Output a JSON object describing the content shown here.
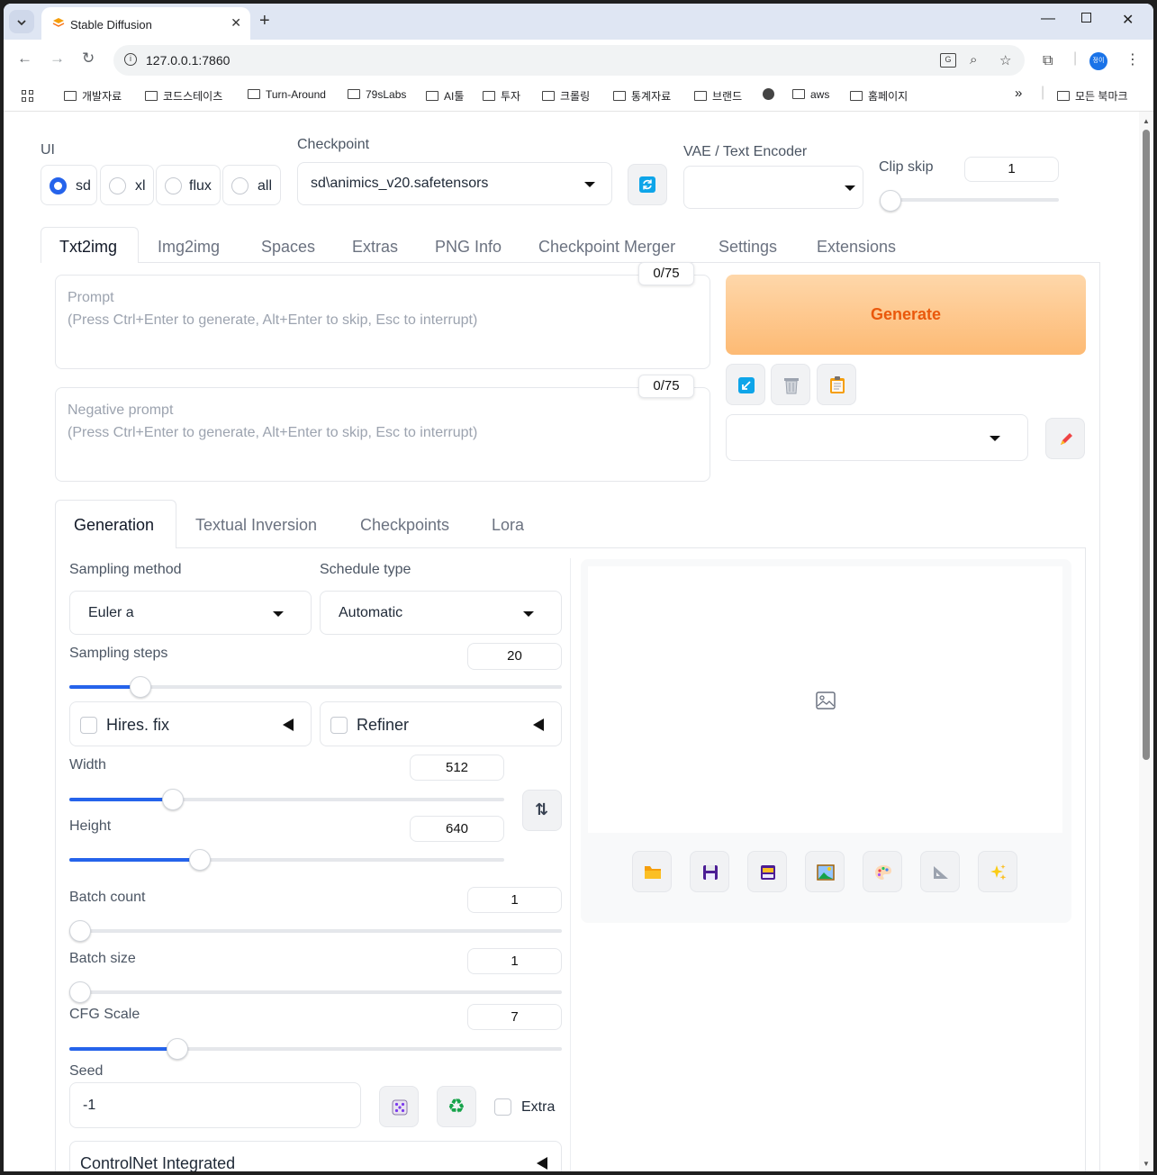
{
  "browser": {
    "tab_title": "Stable Diffusion",
    "tab_menu_icon": "chevron-down-icon",
    "new_tab": "+",
    "url": "127.0.0.1:7860",
    "bookmarks": [
      "개발자료",
      "코드스테이츠",
      "Turn-Around",
      "79sLabs",
      "AI툴",
      "투자",
      "크롤링",
      "통계자료",
      "브랜드",
      "aws",
      "홈페이지"
    ],
    "all_bookmarks": "모든 북마크",
    "more": "»",
    "profile_text": "정이"
  },
  "top": {
    "ui_label": "UI",
    "ui_options": [
      "sd",
      "xl",
      "flux",
      "all"
    ],
    "ui_selected": "sd",
    "checkpoint_label": "Checkpoint",
    "checkpoint_value": "sd\\animics_v20.safetensors",
    "vae_label": "VAE / Text Encoder",
    "vae_value": "",
    "clip_skip_label": "Clip skip",
    "clip_skip_value": "1",
    "clip_skip_level": 0
  },
  "main_tabs": [
    "Txt2img",
    "Img2img",
    "Spaces",
    "Extras",
    "PNG Info",
    "Checkpoint Merger",
    "Settings",
    "Extensions"
  ],
  "main_tab_active": "Txt2img",
  "prompt": {
    "counter": "0/75",
    "label": "Prompt",
    "hint": "(Press Ctrl+Enter to generate, Alt+Enter to skip, Esc to interrupt)"
  },
  "negative_prompt": {
    "counter": "0/75",
    "label": "Negative prompt",
    "hint": "(Press Ctrl+Enter to generate, Alt+Enter to skip, Esc to interrupt)"
  },
  "generate_label": "Generate",
  "style_dropdown_value": "",
  "sub_tabs": [
    "Generation",
    "Textual Inversion",
    "Checkpoints",
    "Lora"
  ],
  "sub_tab_active": "Generation",
  "generation": {
    "sampling_method_label": "Sampling method",
    "sampling_method": "Euler a",
    "schedule_type_label": "Schedule type",
    "schedule_type": "Automatic",
    "sampling_steps_label": "Sampling steps",
    "sampling_steps": "20",
    "hires_label": "Hires. fix",
    "refiner_label": "Refiner",
    "width_label": "Width",
    "width": "512",
    "height_label": "Height",
    "height": "640",
    "batch_count_label": "Batch count",
    "batch_count": "1",
    "batch_size_label": "Batch size",
    "batch_size": "1",
    "cfg_label": "CFG Scale",
    "cfg": "7",
    "seed_label": "Seed",
    "seed": "-1",
    "extra_label": "Extra",
    "controlnet_label": "ControlNet Integrated"
  },
  "colors": {
    "accent": "#2563eb",
    "generate_bg_start": "#fed7aa",
    "generate_bg_end": "#fdba74",
    "generate_text": "#ea580c"
  }
}
